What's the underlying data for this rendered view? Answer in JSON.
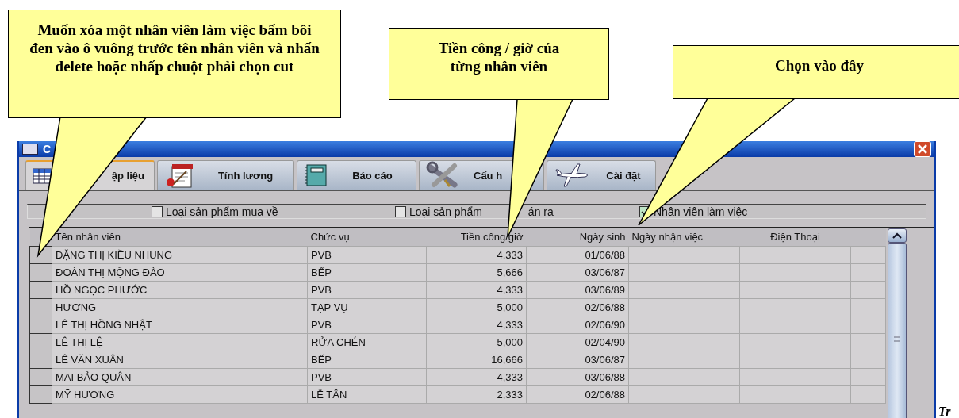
{
  "callouts": [
    {
      "text": "Muốn xóa một nhân viên làm việc bấm bôi đen vào ô vuông trước tên nhân viên và nhấn delete hoặc nhấp chuột phải chọn cut"
    },
    {
      "text": "Tiền công / giờ của từng nhân viên"
    },
    {
      "text": "Chọn vào đây"
    }
  ],
  "window": {
    "title": "C"
  },
  "tabs": [
    {
      "label": "ập liệu",
      "kind": "grid",
      "selected": true
    },
    {
      "label": "Tính lương",
      "kind": "notepad",
      "selected": false
    },
    {
      "label": "Báo cáo",
      "kind": "notebook",
      "selected": false
    },
    {
      "label": "Cấu h",
      "kind": "tools",
      "selected": false
    },
    {
      "label": "Cài đặt",
      "kind": "plane",
      "selected": false
    }
  ],
  "filters": [
    {
      "label": [
        "Loại sản phẩm mua về"
      ],
      "checked": false
    },
    {
      "label": [
        "Loại sản phẩm",
        "án ra"
      ],
      "checked": false
    },
    {
      "label": [
        "Nhân viên làm việc"
      ],
      "checked": true
    }
  ],
  "table": {
    "columns": [
      "Tên nhân viên",
      "Chức vụ",
      "Tiền công/giờ",
      "Ngày sinh",
      "Ngày nhận việc",
      "Điện Thoại"
    ],
    "rows": [
      [
        "ĐẶNG THỊ KIỀU NHUNG",
        "PVB",
        "4,333",
        "01/06/88"
      ],
      [
        "ĐOÀN THỊ MỘNG ĐÀO",
        "BẾP",
        "5,666",
        "03/06/87"
      ],
      [
        "HỒ NGỌC PHƯỚC",
        "PVB",
        "4,333",
        "03/06/89"
      ],
      [
        "HƯƠNG",
        "TẠP VỤ",
        "5,000",
        "02/06/88"
      ],
      [
        "LÊ THỊ HỒNG NHẬT",
        "PVB",
        "4,333",
        "02/06/90"
      ],
      [
        "LÊ THỊ LỆ",
        "RỬA CHÉN",
        "5,000",
        "02/04/90"
      ],
      [
        "LÊ VĂN XUÂN",
        "BẾP",
        "16,666",
        "03/06/87"
      ],
      [
        "MAI BẢO QUÂN",
        "PVB",
        "4,333",
        "03/06/88"
      ],
      [
        "MỸ HƯƠNG",
        "LỄ TÂN",
        "2,333",
        "02/06/88"
      ]
    ]
  },
  "page_text": "Tr"
}
